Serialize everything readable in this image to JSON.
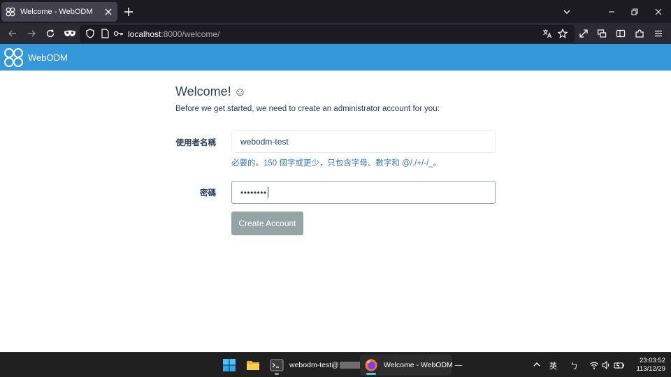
{
  "browser": {
    "tab_title": "Welcome - WebODM",
    "url_host": "localhost",
    "url_rest": ":8000/welcome/"
  },
  "app": {
    "brand": "WebODM",
    "brand_color": "#3498db"
  },
  "page": {
    "title": "Welcome!",
    "title_emoji": "☺",
    "intro": "Before we get started, we need to create an administrator account for you:",
    "username_label": "使用者名稱",
    "username_value": "webodm-test",
    "username_help": "必要的。150 個字或更少，只包含字母、數字和 @/./+/-/_。",
    "password_label": "密碼",
    "password_masked": "••••••••",
    "create_button": "Create Account"
  },
  "taskbar": {
    "terminal_label": "webodm-test@",
    "firefox_label": "Welcome - WebODM —",
    "ime_lang": "英",
    "ime_mode": "ㄅ",
    "time": "23:03:52",
    "date": "113/12/29"
  },
  "icons": {
    "tab_favicon": "webodm-logo-icon",
    "tab_close": "close-icon",
    "new_tab": "plus-icon",
    "back": "arrow-left-icon",
    "forward": "arrow-right-icon",
    "reload": "reload-icon",
    "private": "mask-icon",
    "shield": "shield-icon",
    "page": "page-icon",
    "key": "key-icon",
    "translate": "translate-icon",
    "bookmark": "star-icon"
  }
}
